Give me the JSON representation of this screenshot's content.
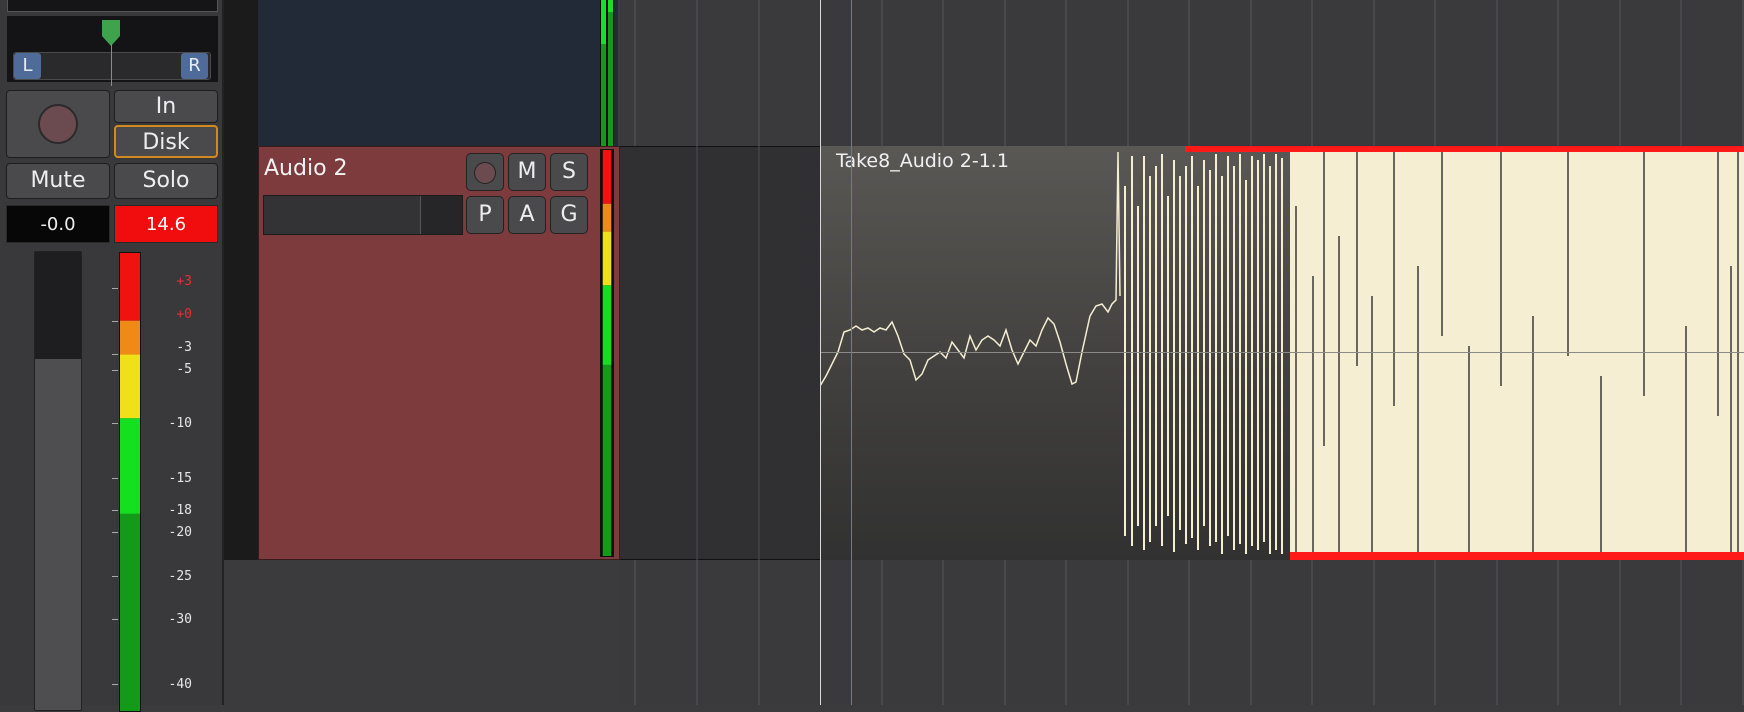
{
  "mixer_strip": {
    "pan": {
      "left_label": "L",
      "right_label": "R"
    },
    "input_button": "In",
    "disk_button": "Disk",
    "mute_button": "Mute",
    "solo_button": "Solo",
    "gain_value": "-0.0",
    "peak_value": "14.6",
    "meter_scale": [
      "+3",
      "+0",
      "-3",
      "-5",
      "-10",
      "-15",
      "-18",
      "-20",
      "-25",
      "-30",
      "-40"
    ]
  },
  "track": {
    "name": "Audio 2",
    "buttons": {
      "mute": "M",
      "solo": "S",
      "playlist": "P",
      "automation": "A",
      "group": "G"
    }
  },
  "region": {
    "name": "Take8_Audio 2-1.1"
  },
  "colors": {
    "track_color": "#7d3b3e",
    "peak_red": "#f10d0d",
    "waveform_fill": "#f5eed2",
    "clip_indicator": "#ff1a1a",
    "disk_outline": "#d18a1f",
    "pan_chip": "#4e6b99"
  }
}
